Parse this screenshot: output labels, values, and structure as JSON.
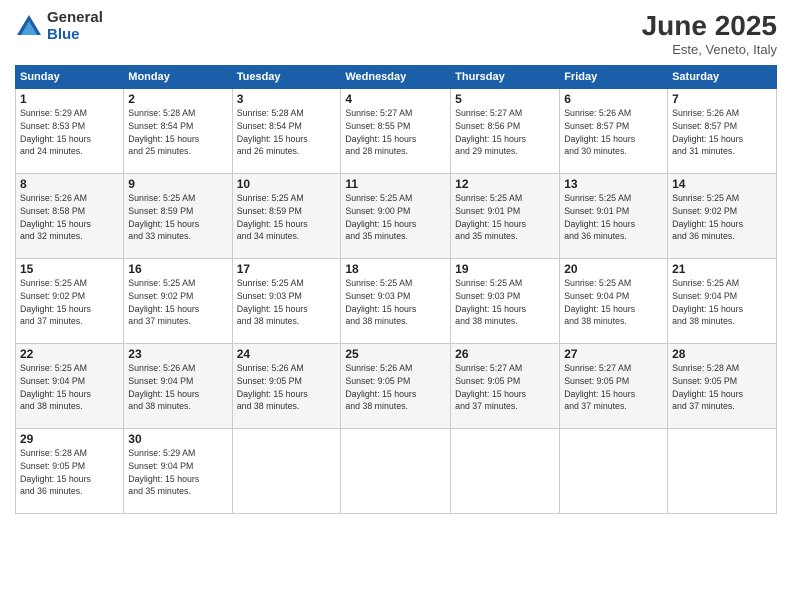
{
  "logo": {
    "general": "General",
    "blue": "Blue"
  },
  "title": "June 2025",
  "subtitle": "Este, Veneto, Italy",
  "days_header": [
    "Sunday",
    "Monday",
    "Tuesday",
    "Wednesday",
    "Thursday",
    "Friday",
    "Saturday"
  ],
  "weeks": [
    [
      {
        "day": "1",
        "info": "Sunrise: 5:29 AM\nSunset: 8:53 PM\nDaylight: 15 hours\nand 24 minutes."
      },
      {
        "day": "2",
        "info": "Sunrise: 5:28 AM\nSunset: 8:54 PM\nDaylight: 15 hours\nand 25 minutes."
      },
      {
        "day": "3",
        "info": "Sunrise: 5:28 AM\nSunset: 8:54 PM\nDaylight: 15 hours\nand 26 minutes."
      },
      {
        "day": "4",
        "info": "Sunrise: 5:27 AM\nSunset: 8:55 PM\nDaylight: 15 hours\nand 28 minutes."
      },
      {
        "day": "5",
        "info": "Sunrise: 5:27 AM\nSunset: 8:56 PM\nDaylight: 15 hours\nand 29 minutes."
      },
      {
        "day": "6",
        "info": "Sunrise: 5:26 AM\nSunset: 8:57 PM\nDaylight: 15 hours\nand 30 minutes."
      },
      {
        "day": "7",
        "info": "Sunrise: 5:26 AM\nSunset: 8:57 PM\nDaylight: 15 hours\nand 31 minutes."
      }
    ],
    [
      {
        "day": "8",
        "info": "Sunrise: 5:26 AM\nSunset: 8:58 PM\nDaylight: 15 hours\nand 32 minutes."
      },
      {
        "day": "9",
        "info": "Sunrise: 5:25 AM\nSunset: 8:59 PM\nDaylight: 15 hours\nand 33 minutes."
      },
      {
        "day": "10",
        "info": "Sunrise: 5:25 AM\nSunset: 8:59 PM\nDaylight: 15 hours\nand 34 minutes."
      },
      {
        "day": "11",
        "info": "Sunrise: 5:25 AM\nSunset: 9:00 PM\nDaylight: 15 hours\nand 35 minutes."
      },
      {
        "day": "12",
        "info": "Sunrise: 5:25 AM\nSunset: 9:01 PM\nDaylight: 15 hours\nand 35 minutes."
      },
      {
        "day": "13",
        "info": "Sunrise: 5:25 AM\nSunset: 9:01 PM\nDaylight: 15 hours\nand 36 minutes."
      },
      {
        "day": "14",
        "info": "Sunrise: 5:25 AM\nSunset: 9:02 PM\nDaylight: 15 hours\nand 36 minutes."
      }
    ],
    [
      {
        "day": "15",
        "info": "Sunrise: 5:25 AM\nSunset: 9:02 PM\nDaylight: 15 hours\nand 37 minutes."
      },
      {
        "day": "16",
        "info": "Sunrise: 5:25 AM\nSunset: 9:02 PM\nDaylight: 15 hours\nand 37 minutes."
      },
      {
        "day": "17",
        "info": "Sunrise: 5:25 AM\nSunset: 9:03 PM\nDaylight: 15 hours\nand 38 minutes."
      },
      {
        "day": "18",
        "info": "Sunrise: 5:25 AM\nSunset: 9:03 PM\nDaylight: 15 hours\nand 38 minutes."
      },
      {
        "day": "19",
        "info": "Sunrise: 5:25 AM\nSunset: 9:03 PM\nDaylight: 15 hours\nand 38 minutes."
      },
      {
        "day": "20",
        "info": "Sunrise: 5:25 AM\nSunset: 9:04 PM\nDaylight: 15 hours\nand 38 minutes."
      },
      {
        "day": "21",
        "info": "Sunrise: 5:25 AM\nSunset: 9:04 PM\nDaylight: 15 hours\nand 38 minutes."
      }
    ],
    [
      {
        "day": "22",
        "info": "Sunrise: 5:25 AM\nSunset: 9:04 PM\nDaylight: 15 hours\nand 38 minutes."
      },
      {
        "day": "23",
        "info": "Sunrise: 5:26 AM\nSunset: 9:04 PM\nDaylight: 15 hours\nand 38 minutes."
      },
      {
        "day": "24",
        "info": "Sunrise: 5:26 AM\nSunset: 9:05 PM\nDaylight: 15 hours\nand 38 minutes."
      },
      {
        "day": "25",
        "info": "Sunrise: 5:26 AM\nSunset: 9:05 PM\nDaylight: 15 hours\nand 38 minutes."
      },
      {
        "day": "26",
        "info": "Sunrise: 5:27 AM\nSunset: 9:05 PM\nDaylight: 15 hours\nand 37 minutes."
      },
      {
        "day": "27",
        "info": "Sunrise: 5:27 AM\nSunset: 9:05 PM\nDaylight: 15 hours\nand 37 minutes."
      },
      {
        "day": "28",
        "info": "Sunrise: 5:28 AM\nSunset: 9:05 PM\nDaylight: 15 hours\nand 37 minutes."
      }
    ],
    [
      {
        "day": "29",
        "info": "Sunrise: 5:28 AM\nSunset: 9:05 PM\nDaylight: 15 hours\nand 36 minutes."
      },
      {
        "day": "30",
        "info": "Sunrise: 5:29 AM\nSunset: 9:04 PM\nDaylight: 15 hours\nand 35 minutes."
      },
      {
        "day": "",
        "info": ""
      },
      {
        "day": "",
        "info": ""
      },
      {
        "day": "",
        "info": ""
      },
      {
        "day": "",
        "info": ""
      },
      {
        "day": "",
        "info": ""
      }
    ]
  ]
}
